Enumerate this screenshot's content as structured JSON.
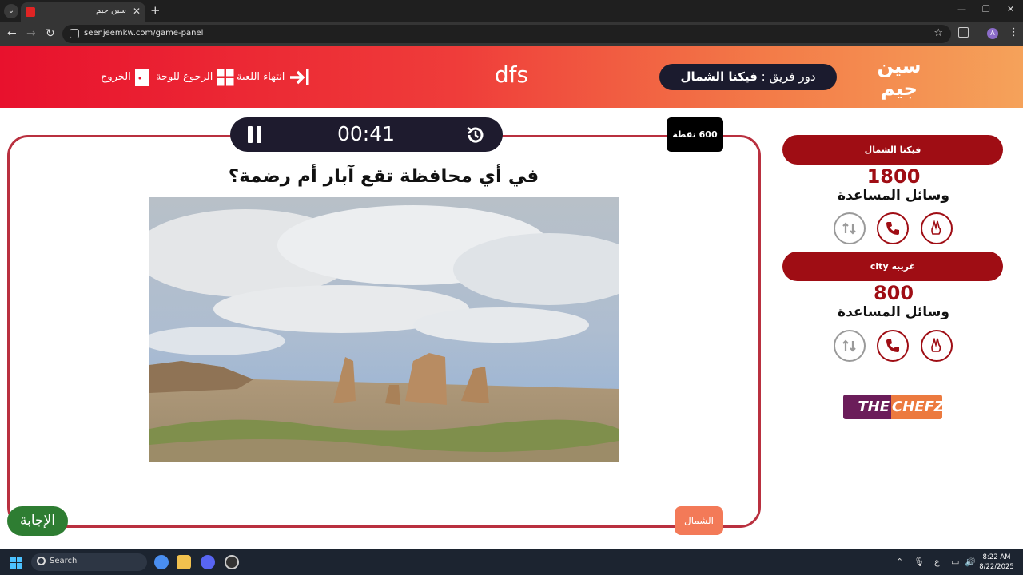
{
  "browser": {
    "tab_title": "سين جيم",
    "url": "seenjeemkw.com/game-panel",
    "profile_initial": "A"
  },
  "header": {
    "logo_text": "سين جيم",
    "turn_prefix": "دور فريق :",
    "turn_team": "فيكنا الشمال",
    "game_name": "dfs",
    "end_game": "انتهاء اللعبة",
    "back_to_board": "الرجوع للوحة",
    "exit": "الخروج"
  },
  "question": {
    "timer": "00:41",
    "points": "600 نقطة",
    "text": "في أي محافظة تقع آبار أم رضمة؟",
    "answer_label": "الإجابة",
    "team_tag": "الشمال"
  },
  "teams": [
    {
      "name": "فيكنا الشمال",
      "score": "1800",
      "aids_label": "وسائل المساعدة",
      "aids": [
        "two-answers-icon",
        "phone-icon",
        "swap-icon"
      ],
      "used": [
        "swap-icon"
      ]
    },
    {
      "name": "غريبه city",
      "score": "800",
      "aids_label": "وسائل المساعدة",
      "aids": [
        "two-answers-icon",
        "phone-icon",
        "swap-icon"
      ],
      "used": [
        "swap-icon"
      ]
    }
  ],
  "sponsor": {
    "left": "THE",
    "right": "CHEFZ"
  },
  "taskbar": {
    "search_label": "Search",
    "time": "8:22 AM",
    "date": "8/22/2025",
    "lang": "ع"
  },
  "colors": {
    "accent_red": "#9f0d14",
    "frame_red": "#b9303f",
    "header_gradient_start": "#e8112d",
    "header_gradient_end": "#f5a25a",
    "answer_green": "#2e7d32",
    "team_tag_orange": "#f37a58"
  }
}
